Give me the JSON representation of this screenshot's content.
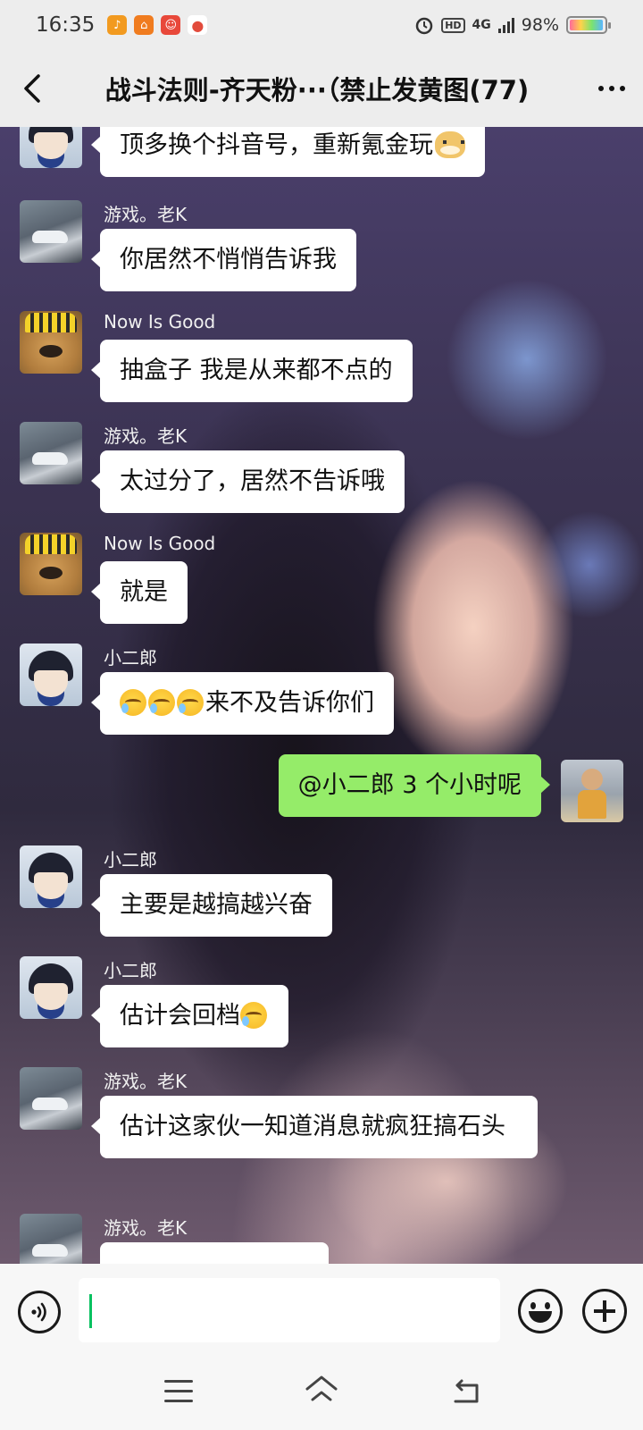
{
  "status_bar": {
    "time": "16:35",
    "network": "4G",
    "hd": "HD",
    "battery": "98%",
    "battery_level": 0.98
  },
  "header": {
    "title": "战斗法则-齐天粉···（禁止发黄图(77)"
  },
  "messages": [
    {
      "sender": "",
      "avatar": "avatar-er",
      "text": "顶多换个抖音号，重新氪金玩",
      "trailing_icon": "doge-emoji-icon"
    },
    {
      "sender": "游戏。老K",
      "avatar": "avatar-laok",
      "text": "你居然不悄悄告诉我"
    },
    {
      "sender": "Now Is Good",
      "avatar": "avatar-now",
      "text": "抽盒子 我是从来都不点的"
    },
    {
      "sender": "游戏。老K",
      "avatar": "avatar-laok",
      "text": "太过分了，居然不告诉哦"
    },
    {
      "sender": "Now Is Good",
      "avatar": "avatar-now",
      "text": "就是"
    },
    {
      "sender": "小二郎",
      "avatar": "avatar-er",
      "text": "来不及告诉你们",
      "leading_icons": [
        "crying-laughing-emoji-icon",
        "crying-laughing-emoji-icon",
        "crying-laughing-emoji-icon"
      ]
    },
    {
      "sender": "",
      "avatar": "avatar-me",
      "text": "@小二郎  3 个小时呢",
      "mine": true
    },
    {
      "sender": "小二郎",
      "avatar": "avatar-er",
      "text": "主要是越搞越兴奋"
    },
    {
      "sender": "小二郎",
      "avatar": "avatar-er",
      "text": "估计会回档",
      "trailing_icon": "crying-laughing-emoji-icon"
    },
    {
      "sender": "游戏。老K",
      "avatar": "avatar-laok",
      "text": "估计这家伙一知道消息就疯狂搞石头"
    },
    {
      "sender": "游戏。老K",
      "avatar": "avatar-laok",
      "text": ""
    }
  ],
  "input": {
    "value": "",
    "placeholder": ""
  },
  "colors": {
    "my_bubble": "#95ec69",
    "other_bubble": "#ffffff",
    "caret": "#07c160",
    "bar_bg": "#ededed"
  }
}
